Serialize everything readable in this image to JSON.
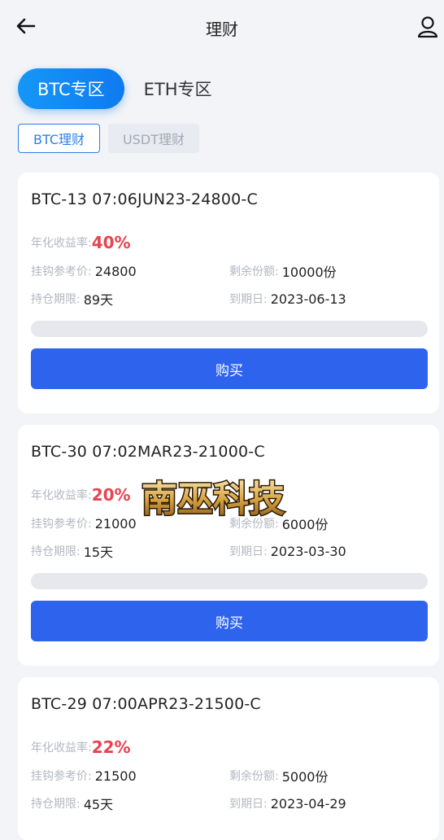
{
  "header": {
    "title": "理财",
    "back_icon": "arrow-left-icon",
    "user_icon": "user-icon"
  },
  "zones": [
    {
      "label": "BTC专区",
      "active": true
    },
    {
      "label": "ETH专区",
      "active": false
    }
  ],
  "subtabs": [
    {
      "label": "BTC理财",
      "active": true
    },
    {
      "label": "USDT理财",
      "active": false
    }
  ],
  "labels": {
    "rate": "年化收益率:",
    "ref_price": "挂钩参考价:",
    "remaining": "剩余份额:",
    "period": "持仓期限:",
    "expiry": "到期日:",
    "buy": "购买"
  },
  "products": [
    {
      "name": "BTC-13 07:06JUN23-24800-C",
      "rate": "40%",
      "ref_price": "24800",
      "remaining": "10000份",
      "period": "89天",
      "expiry": "2023-06-13",
      "progress": 0.0
    },
    {
      "name": "BTC-30 07:02MAR23-21000-C",
      "rate": "20%",
      "ref_price": "21000",
      "remaining": "6000份",
      "period": "15天",
      "expiry": "2023-03-30",
      "progress": 0.0
    },
    {
      "name": "BTC-29 07:00APR23-21500-C",
      "rate": "22%",
      "ref_price": "21500",
      "remaining": "5000份",
      "period": "45天",
      "expiry": "2023-04-29",
      "progress": 0.0
    }
  ],
  "watermark": {
    "text": "南巫科技"
  },
  "colors": {
    "accent": "#2e63ee",
    "rate": "#e8434f",
    "tab_gradient_start": "#1597f7"
  }
}
